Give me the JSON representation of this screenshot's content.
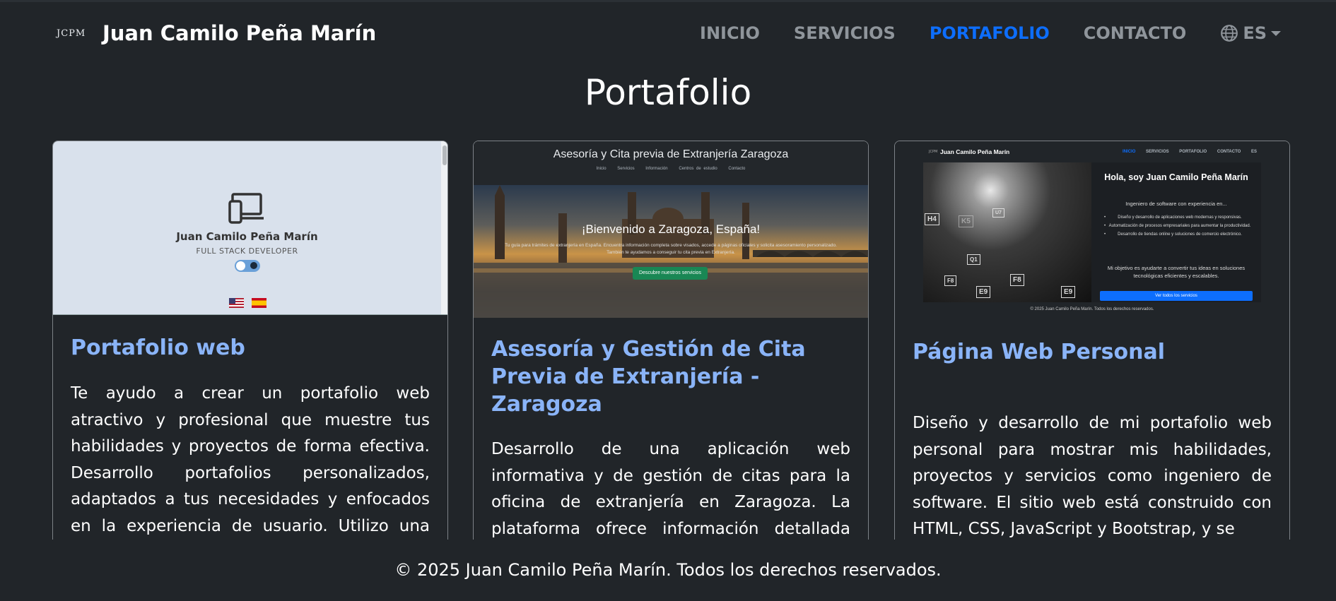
{
  "header": {
    "logo_text": "JCPM",
    "brand": "Juan Camilo Peña Marín",
    "nav": [
      {
        "label": "INICIO",
        "active": false
      },
      {
        "label": "SERVICIOS",
        "active": false
      },
      {
        "label": "PORTAFOLIO",
        "active": true
      },
      {
        "label": "CONTACTO",
        "active": false
      }
    ],
    "language": {
      "label": "ES",
      "icon": "globe-icon"
    }
  },
  "page_title": "Portafolio",
  "cards": [
    {
      "title": "Portafolio web",
      "text": "Te ayudo a crear un portafolio web atractivo y profesional que muestre tus habilidades y proyectos de forma efectiva. Desarrollo portafolios personalizados, adaptados a tus necesidades y enfocados en la experiencia de usuario. Utilizo una variedad de tecnologías,",
      "preview": {
        "name": "Juan Camilo Peña Marín",
        "role": "FULL STACK DEVELOPER"
      }
    },
    {
      "title": "Asesoría y Gestión de Cita Previa de Extranjería - Zaragoza",
      "text": "Desarrollo de una aplicación web informativa y de gestión de citas para la oficina de extranjería en Zaragoza. La plataforma ofrece información detallada sobre los diferentes tipos de visados, requisitos y procedimientos.",
      "preview": {
        "title": "Asesoría y Cita previa de Extranjería Zaragoza",
        "links": [
          "Inicio",
          "Servicios",
          "Información",
          "Centros de estudio",
          "Contacto"
        ],
        "welcome": "¡Bienvenido a Zaragoza, España!",
        "subtitle": "Tu guía para trámites de extranjería en España. Encuentra información completa sobre visados, accede a páginas oficiales y solicita asesoramiento personalizado. También te ayudamos a conseguir tu cita previa en Extranjería.",
        "button": "Descubre nuestros servicios"
      }
    },
    {
      "title": "Página Web Personal",
      "text": "Diseño y desarrollo de mi portafolio web personal para mostrar mis habilidades, proyectos y servicios como ingeniero de software. El sitio web está construido con HTML, CSS, JavaScript y Bootstrap, y se",
      "preview": {
        "logo": "JCPM",
        "brand": "Juan Camilo Peña Marín",
        "nav": [
          "INICIO",
          "SERVICIOS",
          "PORTAFOLIO",
          "CONTACTO",
          "ES"
        ],
        "heading": "Hola, soy Juan Camilo Peña Marín",
        "subheading": "Ingeniero de software con experiencia en...",
        "bullets": [
          "Diseño y desarrollo de aplicaciones web modernas y responsivas.",
          "Automatización de procesos empresariales para aumentar la productividad.",
          "Desarrollo de tiendas online y soluciones de comercio electrónico."
        ],
        "paragraph": "Mi objetivo es ayudarte a convertir tus ideas en soluciones tecnológicas eficientes y escalables.",
        "button": "Ver todos los servicios",
        "footer": "© 2025 Juan Camilo Peña Marín. Todos los derechos reservados.",
        "keys": [
          "H4",
          "K5",
          "U7",
          "Q1",
          "F8",
          "E9",
          "F8",
          "E9"
        ]
      }
    }
  ],
  "footer": {
    "text": "© 2025 Juan Camilo Peña Marín. Todos los derechos reservados."
  },
  "colors": {
    "background": "#212529",
    "accent": "#0d6efd",
    "card_title": "#8ab4f8",
    "nav_inactive": "#8f959b"
  }
}
